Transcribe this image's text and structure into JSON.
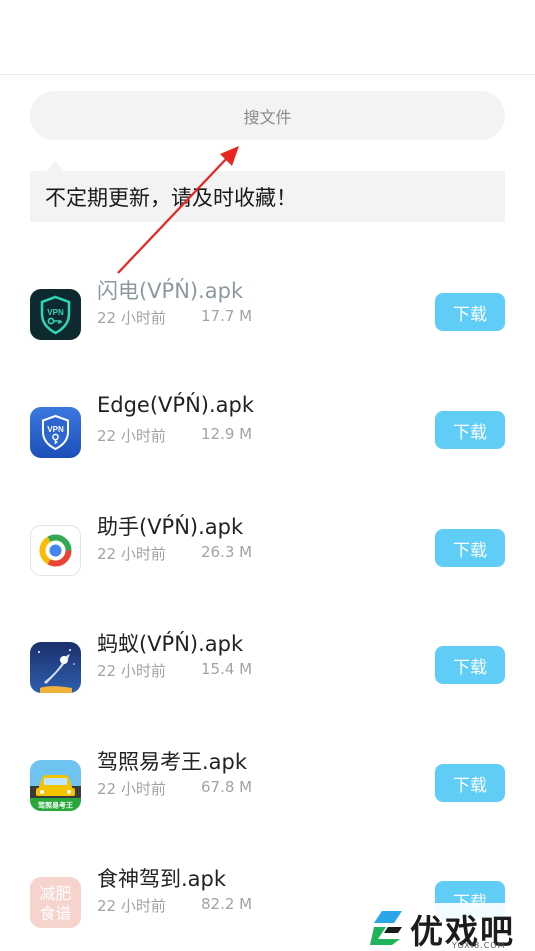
{
  "search": {
    "placeholder": "搜文件"
  },
  "notice": {
    "text": "不定期更新，请及时收藏！"
  },
  "download_label": "下载",
  "files": [
    {
      "name": "闪电(VṔŃ).apk",
      "time": "22 小时前",
      "size": "17.7 M",
      "icon": "shield-vpn-key-icon"
    },
    {
      "name": "Edge(VṔŃ).apk",
      "time": "22 小时前",
      "size": "12.9 M",
      "icon": "shield-vpn-icon"
    },
    {
      "name": "助手(VṔŃ).apk",
      "time": "22 小时前",
      "size": "26.3 M",
      "icon": "ring-logo-icon"
    },
    {
      "name": "蚂蚁(VṔŃ).apk",
      "time": "22 小时前",
      "size": "15.4 M",
      "icon": "rocket-night-icon"
    },
    {
      "name": "驾照易考王.apk",
      "time": "22 小时前",
      "size": "67.8 M",
      "icon": "car-app-icon"
    },
    {
      "name": "食神驾到.apk",
      "time": "22 小时前",
      "size": "82.2 M",
      "icon": "diet-recipe-icon"
    }
  ],
  "icon_labels": {
    "vpn": "VPN",
    "car_banner": "驾照易考王",
    "diet_line1": "减肥",
    "diet_line2": "食谱"
  },
  "watermark": {
    "title": "优戏吧",
    "sub": "YOXI8.COM"
  },
  "colors": {
    "accent": "#5fcdf6",
    "annotation": "#e8241f"
  }
}
